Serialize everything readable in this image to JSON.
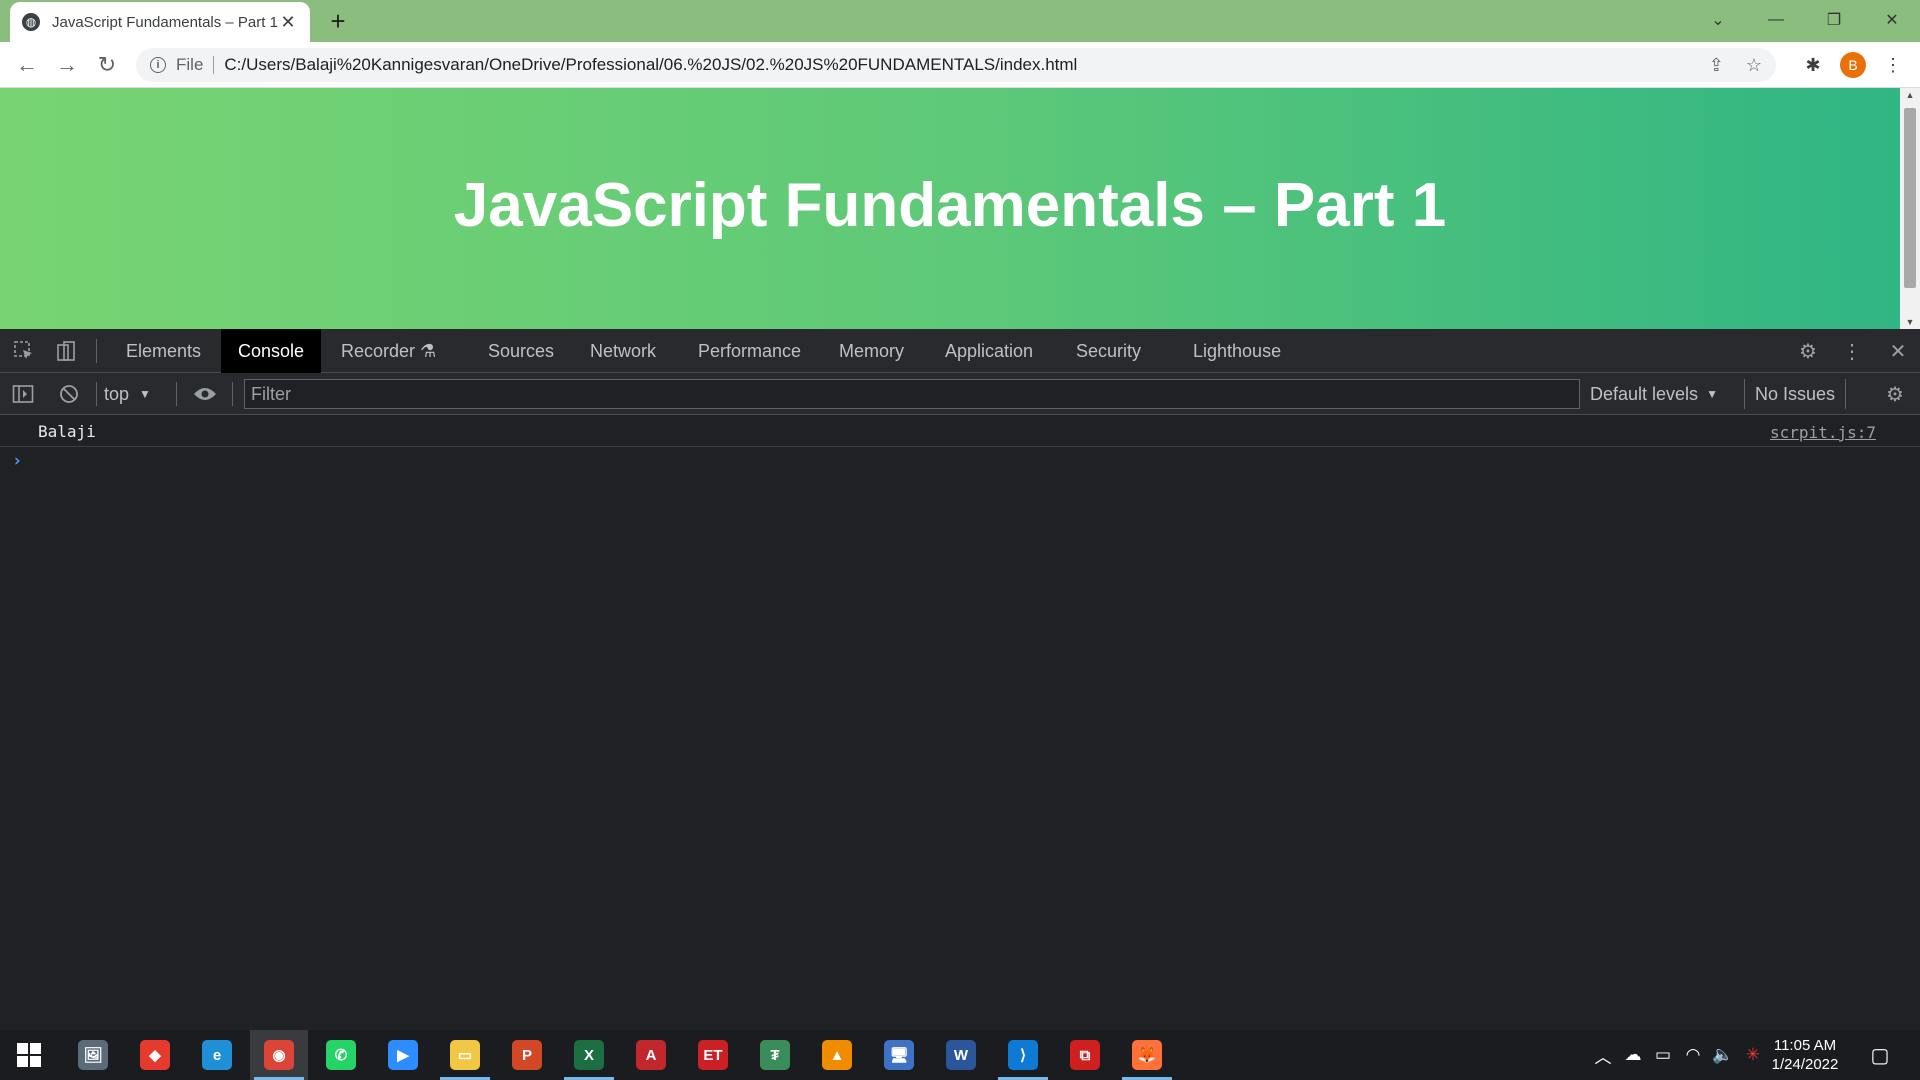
{
  "browser": {
    "tab": {
      "title": "JavaScript Fundamentals – Part 1",
      "close": "✕"
    },
    "new_tab": "+",
    "window_controls": {
      "tabs_dropdown": "⌄",
      "minimize": "—",
      "restore": "❐",
      "close": "✕"
    },
    "toolbar": {
      "back": "←",
      "forward": "→",
      "reload": "↻",
      "scheme_label": "File",
      "url": "C:/Users/Balaji%20Kannigesvaran/OneDrive/Professional/06.%20JS/02.%20JS%20FUNDAMENTALS/index.html",
      "share": "⇪",
      "bookmark": "☆",
      "extensions": "✱",
      "profile_initial": "B",
      "menu": "⋮"
    }
  },
  "page": {
    "heading": "JavaScript Fundamentals – Part 1"
  },
  "devtools": {
    "tabs": [
      {
        "label": "Elements"
      },
      {
        "label": "Console",
        "active": true
      },
      {
        "label": "Recorder ⚗"
      },
      {
        "label": "Sources"
      },
      {
        "label": "Network"
      },
      {
        "label": "Performance"
      },
      {
        "label": "Memory"
      },
      {
        "label": "Application"
      },
      {
        "label": "Security"
      },
      {
        "label": "Lighthouse"
      }
    ],
    "filterbar": {
      "context": "top",
      "filter_placeholder": "Filter",
      "levels": "Default levels",
      "issues": "No Issues"
    },
    "console": {
      "messages": [
        {
          "text": "Balaji",
          "source": "scrpit.js:7"
        }
      ],
      "prompt": "›"
    }
  },
  "taskbar": {
    "clock": {
      "time": "11:05 AM",
      "date": "1/24/2022"
    },
    "apps": [
      {
        "name": "photos",
        "color": "#5c6b7a",
        "glyph": "🖼"
      },
      {
        "name": "anydesk",
        "color": "#e63a2e",
        "glyph": "◆"
      },
      {
        "name": "edge",
        "color": "#1f8fd6",
        "glyph": "e"
      },
      {
        "name": "chrome",
        "color": "#db4437",
        "glyph": "◉"
      },
      {
        "name": "whatsapp",
        "color": "#25d366",
        "glyph": "✆"
      },
      {
        "name": "zoom",
        "color": "#2d8cff",
        "glyph": "▶"
      },
      {
        "name": "file-explorer",
        "color": "#f2c744",
        "glyph": "▭"
      },
      {
        "name": "powerpoint",
        "color": "#d24726",
        "glyph": "P"
      },
      {
        "name": "excel",
        "color": "#1d6f42",
        "glyph": "X"
      },
      {
        "name": "acrobat-reader",
        "color": "#c1272d",
        "glyph": "A"
      },
      {
        "name": "et-money",
        "color": "#cc2027",
        "glyph": "ET"
      },
      {
        "name": "tally",
        "color": "#3a8d5a",
        "glyph": "₮"
      },
      {
        "name": "vlc",
        "color": "#f08c00",
        "glyph": "▲"
      },
      {
        "name": "remote-desktop",
        "color": "#3d72c4",
        "glyph": "🖥"
      },
      {
        "name": "word",
        "color": "#2b579a",
        "glyph": "W"
      },
      {
        "name": "vscode",
        "color": "#0e7ad3",
        "glyph": "⟩"
      },
      {
        "name": "adobe-acrobat",
        "color": "#cf1f1f",
        "glyph": "⧉"
      },
      {
        "name": "firefox",
        "color": "#ff7139",
        "glyph": "🦊"
      }
    ],
    "tray": {
      "chevron": "︿",
      "onedrive": "☁",
      "battery": "▭",
      "wifi": "◠",
      "volume": "🔈",
      "app": "✳",
      "notifications": "▢"
    }
  }
}
